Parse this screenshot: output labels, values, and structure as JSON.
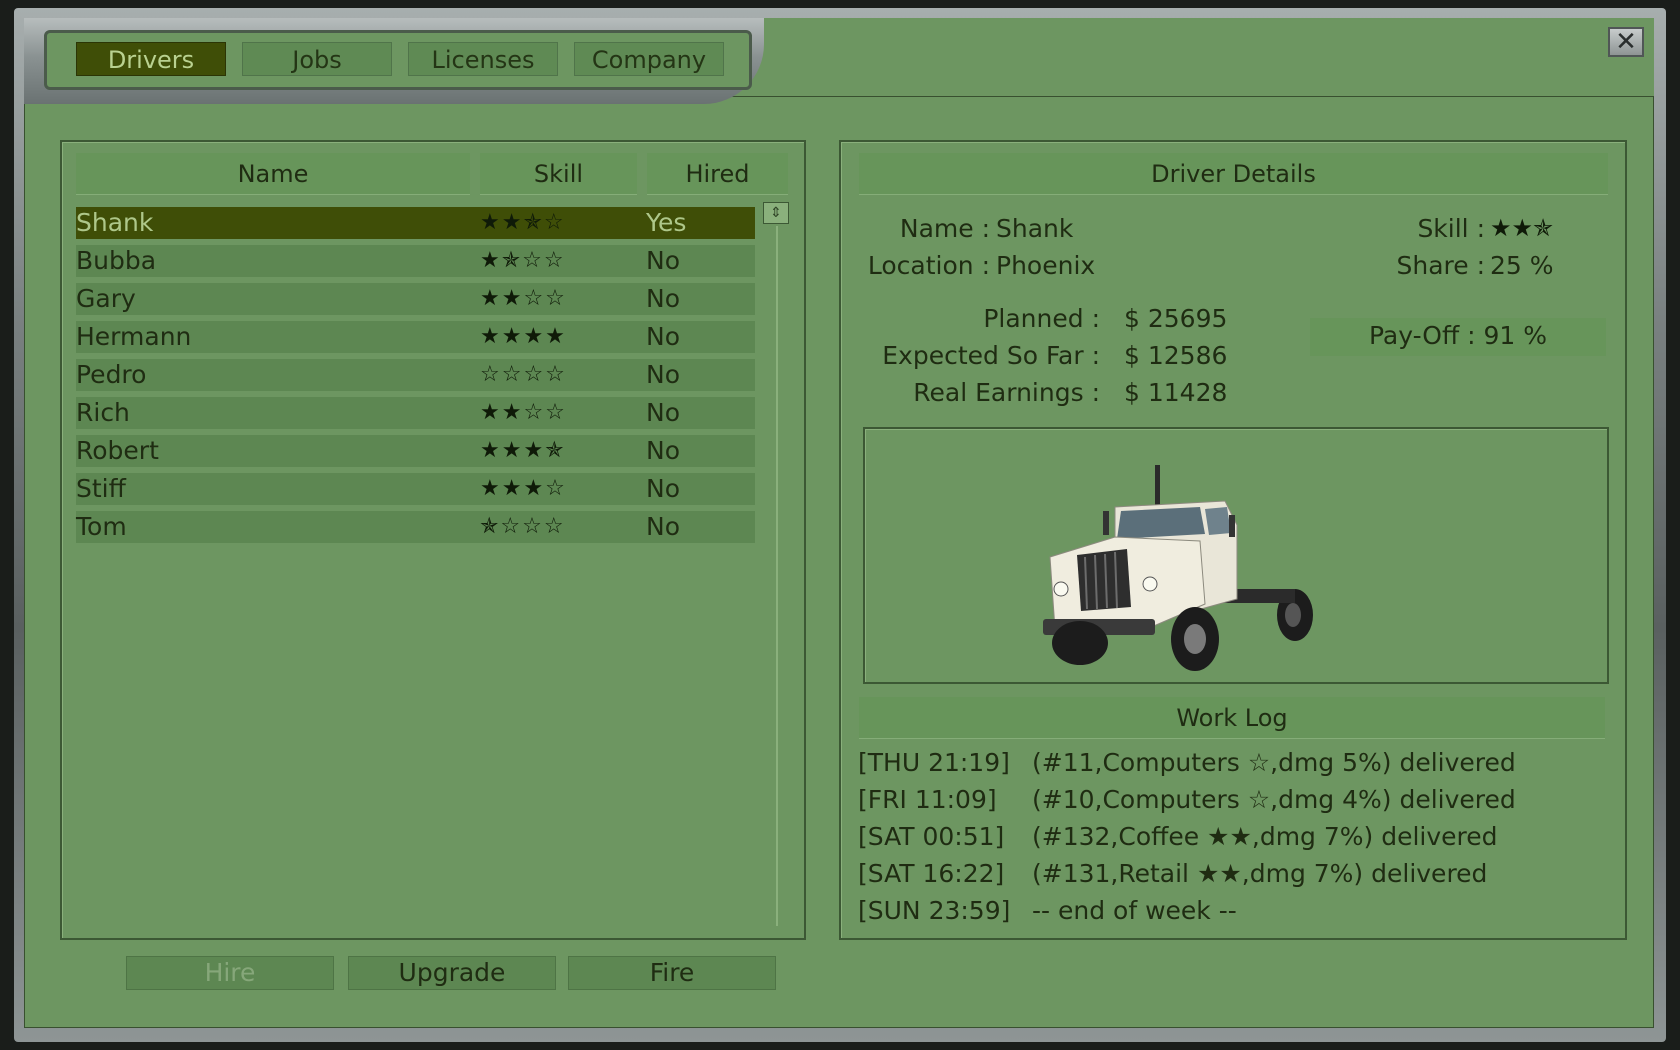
{
  "tabs": [
    {
      "label": "Drivers",
      "active": true
    },
    {
      "label": "Jobs",
      "active": false
    },
    {
      "label": "Licenses",
      "active": false
    },
    {
      "label": "Company",
      "active": false
    }
  ],
  "close_icon": "✕",
  "driver_list": {
    "columns": [
      "Name",
      "Skill",
      "Hired"
    ],
    "rows": [
      {
        "name": "Shank",
        "skill": "★★✯☆",
        "hired": "Yes",
        "selected": true
      },
      {
        "name": "Bubba",
        "skill": "★✯☆☆",
        "hired": "No"
      },
      {
        "name": "Gary",
        "skill": "★★☆☆",
        "hired": "No"
      },
      {
        "name": "Hermann",
        "skill": "★★★★",
        "hired": "No"
      },
      {
        "name": "Pedro",
        "skill": "☆☆☆☆",
        "hired": "No"
      },
      {
        "name": "Rich",
        "skill": "★★☆☆",
        "hired": "No"
      },
      {
        "name": "Robert",
        "skill": "★★★✯",
        "hired": "No"
      },
      {
        "name": "Stiff",
        "skill": "★★★☆",
        "hired": "No"
      },
      {
        "name": "Tom",
        "skill": "✯☆☆☆",
        "hired": "No"
      }
    ]
  },
  "details": {
    "title": "Driver Details",
    "name_label": "Name :",
    "name_value": "Shank",
    "location_label": "Location :",
    "location_value": "Phoenix",
    "skill_label": "Skill :",
    "skill_value": "★★✯",
    "share_label": "Share :",
    "share_value": "25 %",
    "planned_label": "Planned :",
    "planned_value": "$ 25695",
    "expected_label": "Expected So Far :",
    "expected_value": "$ 12586",
    "real_label": "Real Earnings :",
    "real_value": "$ 11428",
    "payoff": "Pay-Off : 91 %"
  },
  "work_log": {
    "title": "Work Log",
    "entries": [
      {
        "time": "[THU 21:19]",
        "text": "(#11,Computers ☆,dmg 5%) delivered"
      },
      {
        "time": "[FRI 11:09]",
        "text": "(#10,Computers ☆,dmg 4%) delivered"
      },
      {
        "time": "[SAT 00:51]",
        "text": "(#132,Coffee ★★,dmg 7%) delivered"
      },
      {
        "time": "[SAT 16:22]",
        "text": "(#131,Retail ★★,dmg 7%) delivered"
      },
      {
        "time": "[SUN 23:59]",
        "text": "-- end of week --"
      }
    ]
  },
  "buttons": {
    "hire": "Hire",
    "upgrade": "Upgrade",
    "fire": "Fire"
  }
}
